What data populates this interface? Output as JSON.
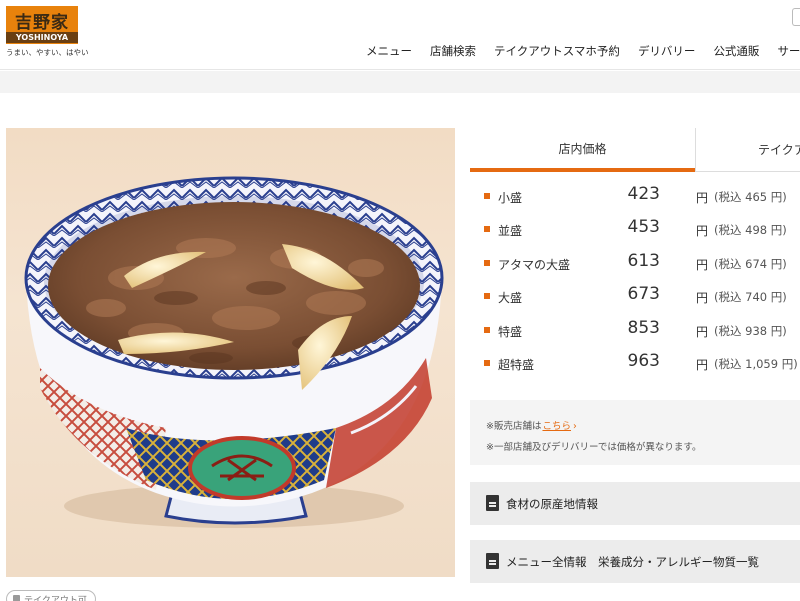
{
  "header": {
    "logo_kanji": "吉野家",
    "logo_latin": "YOSHINOYA",
    "tagline": "うまい、やすい、はやい",
    "nav": [
      "メニュー",
      "店舗検索",
      "テイクアウトスマホ予約",
      "デリバリー",
      "公式通販",
      "サー"
    ]
  },
  "tabs": [
    "店内価格",
    "テイクア"
  ],
  "prices": [
    {
      "size": "小盛",
      "amount": "423",
      "yen": "円",
      "tax": "(税込 465 円)"
    },
    {
      "size": "並盛",
      "amount": "453",
      "yen": "円",
      "tax": "(税込 498 円)"
    },
    {
      "size": "アタマの大盛",
      "amount": "613",
      "yen": "円",
      "tax": "(税込 674 円)"
    },
    {
      "size": "大盛",
      "amount": "673",
      "yen": "円",
      "tax": "(税込 740 円)"
    },
    {
      "size": "特盛",
      "amount": "853",
      "yen": "円",
      "tax": "(税込 938 円)"
    },
    {
      "size": "超特盛",
      "amount": "963",
      "yen": "円",
      "tax": "(税込 1,059 円)"
    }
  ],
  "notes": {
    "line1_prefix": "※販売店舗は",
    "line1_link": "こちら",
    "line2": "※一部店舗及びデリバリーでは価格が異なります。"
  },
  "buttons": {
    "origin": "食材の原産地情報",
    "allergy": "メニュー全情報　栄養成分・アレルギー物質一覧"
  },
  "badge": "テイクアウト可",
  "colors": {
    "accent": "#e56a11",
    "logo": "#e8820c"
  }
}
